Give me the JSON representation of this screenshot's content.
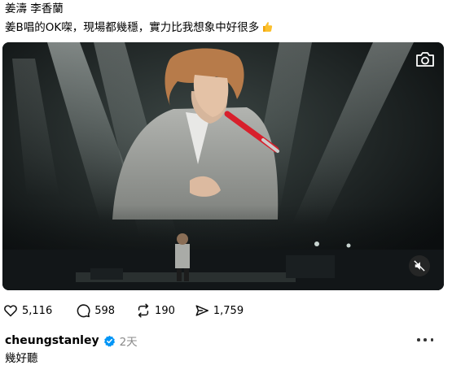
{
  "post": {
    "caption_line1": "姜濤 李香蘭",
    "caption_line2": "姜B唱的OK㗎，現場都幾穩，實力比我想象中好很多",
    "caption_emoji": "thumbs-up-emoji"
  },
  "video": {
    "camera_icon": "camera-icon",
    "mute_icon": "speaker-muted-icon",
    "colors": {
      "stage": "#0c0f10",
      "mic": "#d8202c",
      "suit": "#a8aaa6"
    }
  },
  "actions": [
    {
      "icon": "heart-icon",
      "count": "5,116"
    },
    {
      "icon": "comment-icon",
      "count": "598"
    },
    {
      "icon": "repost-icon",
      "count": "190"
    },
    {
      "icon": "share-icon",
      "count": "1,759"
    }
  ],
  "reply": {
    "username": "cheungstanley",
    "verified_color": "#0095f6",
    "time": "2天",
    "text": "幾好聽",
    "more_icon": "more-options-icon"
  }
}
